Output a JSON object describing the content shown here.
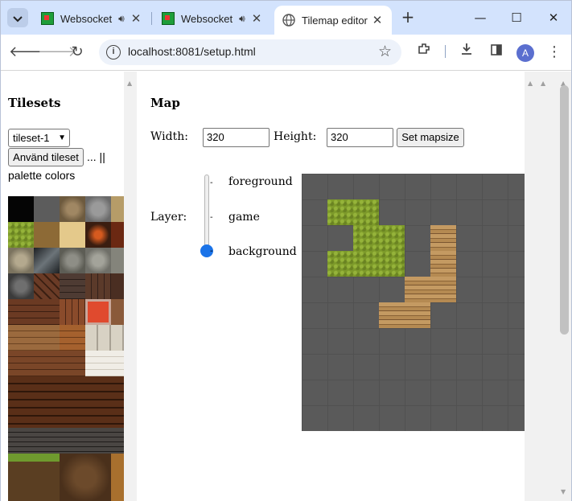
{
  "browser": {
    "tabs": [
      {
        "title": "Websocket",
        "audio": true
      },
      {
        "title": "Websocket",
        "audio": true
      },
      {
        "title": "Tilemap editor",
        "active": true
      }
    ],
    "url": "localhost:8081/setup.html",
    "profile_initial": "A"
  },
  "left": {
    "heading": "Tilesets",
    "tileset_select": "tileset-1",
    "apply_button": "Använd tileset",
    "ellipsis": "... ||",
    "palette_label": "palette colors"
  },
  "main": {
    "heading": "Map",
    "width_label": "Width:",
    "width_value": "320",
    "height_label": "Height:",
    "height_value": "320",
    "set_mapsize_button": "Set mapsize",
    "layer_label": "Layer:",
    "layers": [
      "foreground",
      "game",
      "background"
    ],
    "selected_layer": "background"
  },
  "colors": {
    "tabstrip": "#d3e3fd",
    "accent": "#1a73e8",
    "map_background": "#5a5a5a"
  }
}
